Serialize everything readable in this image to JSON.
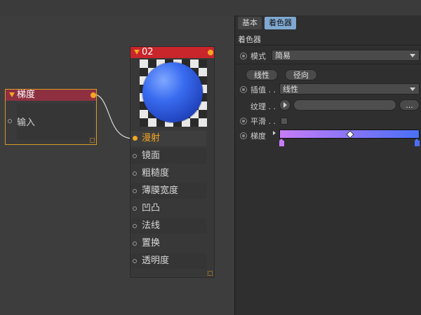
{
  "gradient_node": {
    "title": "梯度",
    "input_label": "输入",
    "header_color": "#8e3040",
    "border_color": "#d49a2a"
  },
  "material_node": {
    "title": "02",
    "header_color": "#c8262b",
    "channels": [
      {
        "label": "漫射",
        "active": true
      },
      {
        "label": "镜面",
        "active": false
      },
      {
        "label": "粗糙度",
        "active": false
      },
      {
        "label": "薄膜宽度",
        "active": false
      },
      {
        "label": "凹凸",
        "active": false
      },
      {
        "label": "法线",
        "active": false
      },
      {
        "label": "置换",
        "active": false
      },
      {
        "label": "透明度",
        "active": false
      }
    ]
  },
  "panel": {
    "tabs": [
      {
        "label": "基本",
        "active": false
      },
      {
        "label": "着色器",
        "active": true
      }
    ],
    "section_title": "着色器",
    "mode": {
      "label": "模式",
      "value": "简易"
    },
    "buttons": {
      "linear": "线性",
      "radial": "径向"
    },
    "interpolation": {
      "label": "插值 . .",
      "value": "线性"
    },
    "texture": {
      "label": "纹理 . .",
      "more": "..."
    },
    "smooth": {
      "label": "平滑 . ."
    },
    "gradient": {
      "label": "梯度",
      "color_start": "#c77cf7",
      "color_end": "#4a6ff6"
    }
  },
  "colors": {
    "accent": "#f5a623",
    "tab_active": "#7fa9d1"
  }
}
